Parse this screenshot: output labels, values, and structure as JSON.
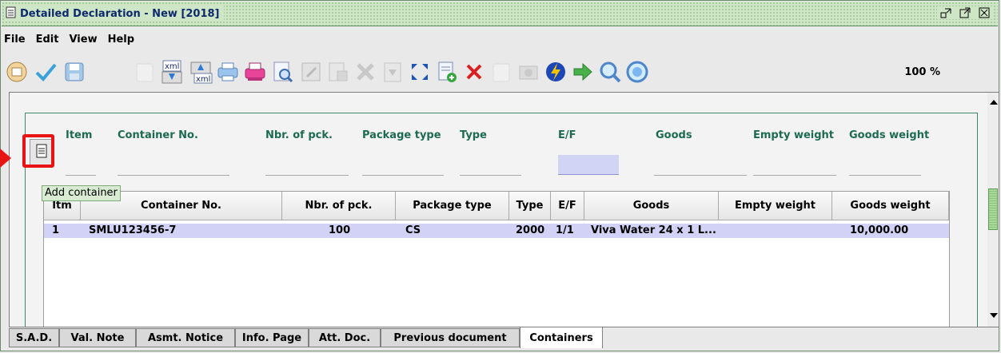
{
  "window": {
    "title": "Detailed Declaration - New [2018]"
  },
  "menu": [
    "File",
    "Edit",
    "View",
    "Help"
  ],
  "toolbar": {
    "icons": [
      "open-icon",
      "verify-icon",
      "save-icon",
      "blank-icon",
      "xml-export-icon",
      "xml-import-icon",
      "print-icon",
      "print-pink-icon",
      "print-preview-icon",
      "edit-icon",
      "edit-disabled-icon",
      "delete-disabled-icon",
      "document-disabled-icon",
      "expand-icon",
      "add-page-icon",
      "delete-icon",
      "blank-icon",
      "camera-icon",
      "lightning-icon",
      "next-arrow-icon",
      "search-icon",
      "help-icon"
    ],
    "zoom": "100 %"
  },
  "form": {
    "headers": [
      "Item",
      "Container No.",
      "Nbr. of pck.",
      "Package type",
      "Type",
      "E/F",
      "Goods",
      "Empty weight",
      "Goods weight"
    ],
    "add_tooltip": "Add container"
  },
  "table": {
    "columns": [
      "Itm",
      "Container No.",
      "Nbr. of pck.",
      "Package type",
      "Type",
      "E/F",
      "Goods",
      "Empty weight",
      "Goods weight"
    ],
    "rows": [
      {
        "itm": "1",
        "container_no": "SMLU123456-7",
        "nbr": "100",
        "package_type": "CS",
        "type": "2000",
        "ef": "1/1",
        "goods": "Viva Water 24 x 1 L...",
        "empty_weight": "",
        "goods_weight": "10,000.00"
      }
    ]
  },
  "tabs": [
    "S.A.D.",
    "Val. Note",
    "Asmt. Notice",
    "Info. Page",
    "Att. Doc.",
    "Previous document",
    "Containers"
  ],
  "active_tab": "Containers",
  "colors": {
    "accent_red": "#e81414",
    "selected_row": "#d1d2f5",
    "header_green": "#1d6a52"
  }
}
